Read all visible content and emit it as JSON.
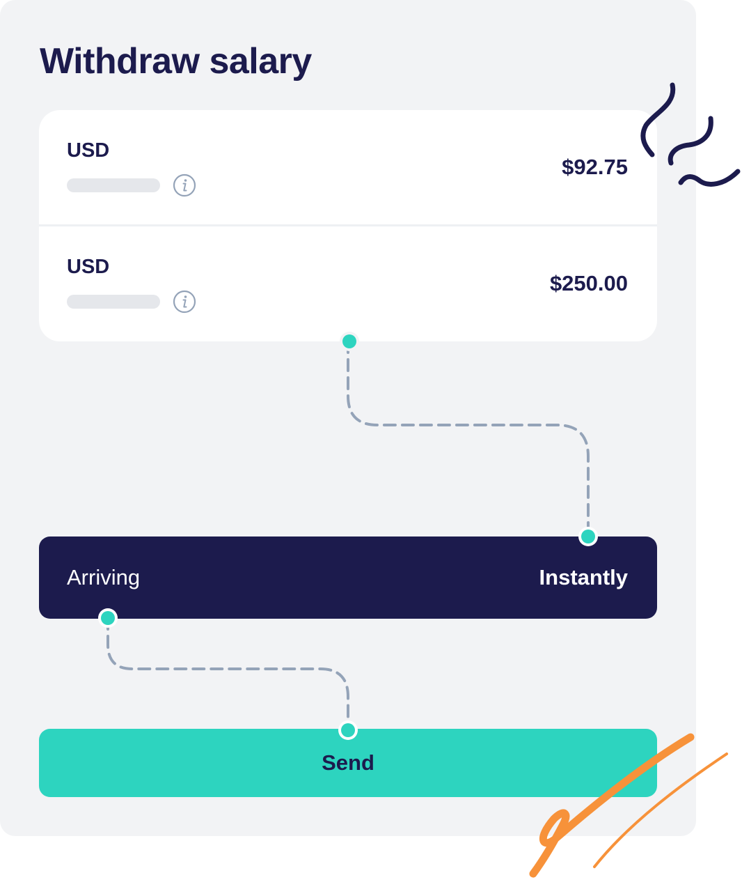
{
  "title": "Withdraw salary",
  "rows": [
    {
      "currency": "USD",
      "amount": "$92.75"
    },
    {
      "currency": "USD",
      "amount": "$250.00"
    }
  ],
  "arriving": {
    "label": "Arriving",
    "value": "Instantly"
  },
  "send_label": "Send",
  "icons": {
    "info": "info-icon",
    "connector_dot": "connector-dot-icon",
    "squiggle_decoration": "squiggle-decoration-icon",
    "scribble_decoration": "scribble-decoration-icon"
  },
  "colors": {
    "navy": "#1c1b4d",
    "teal": "#2dd4bf",
    "panel_bg": "#f2f3f5",
    "dash_line": "#94a3b8",
    "orange_accent": "#f7923a",
    "placeholder": "#e5e7eb"
  }
}
